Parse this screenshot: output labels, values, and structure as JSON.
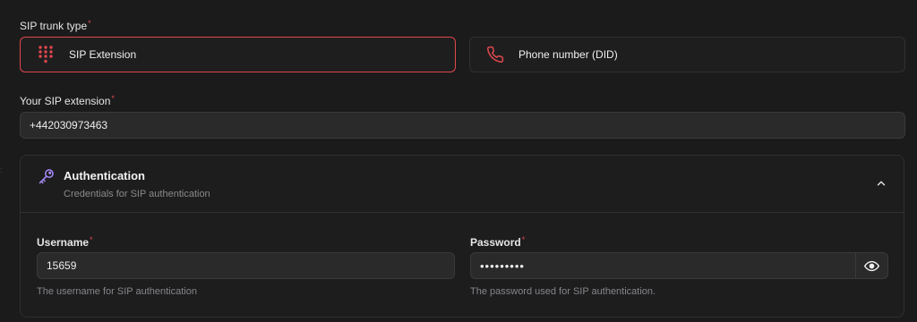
{
  "trunk_type": {
    "label": "SIP trunk type",
    "required_mark": "*",
    "options": [
      {
        "label": "SIP Extension",
        "icon": "dialpad-icon",
        "selected": true
      },
      {
        "label": "Phone number (DID)",
        "icon": "phone-icon",
        "selected": false
      }
    ]
  },
  "extension": {
    "label": "Your SIP extension",
    "required_mark": "*",
    "value": "+442030973463"
  },
  "auth": {
    "title": "Authentication",
    "subtitle": "Credentials for SIP authentication",
    "icon": "key-icon",
    "collapse_icon": "chevron-up-icon",
    "username": {
      "label": "Username",
      "required_mark": "*",
      "value": "15659",
      "hint": "The username for SIP authentication"
    },
    "password": {
      "label": "Password",
      "required_mark": "*",
      "value": "•••••••••",
      "hint": "The password used for SIP authentication.",
      "toggle_icon": "eye-icon"
    }
  },
  "colors": {
    "accent": "#e0474c",
    "key_icon": "#a78bfa",
    "background": "#1b1b1c"
  }
}
